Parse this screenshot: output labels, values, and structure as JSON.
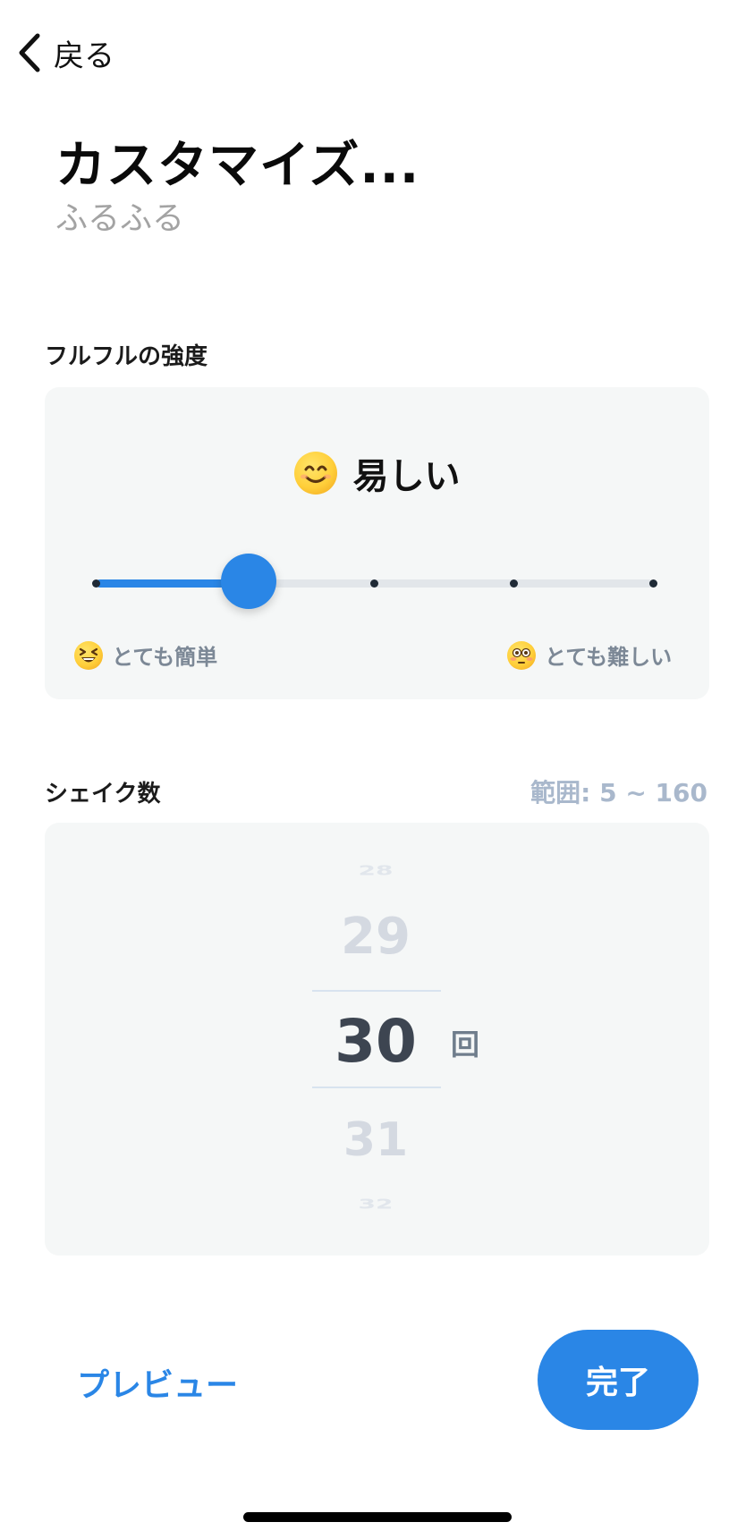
{
  "nav": {
    "back_label": "戻る"
  },
  "header": {
    "title": "カスタマイズ...",
    "subtitle": "ふるふる"
  },
  "intensity": {
    "section_label": "フルフルの強度",
    "current_level": "易しい",
    "current_emoji": "smiling-face-icon",
    "min_label": "とても簡単",
    "min_emoji": "grinning-squinting-face-icon",
    "max_label": "とても難しい",
    "max_emoji": "flushed-face-icon",
    "steps": 5,
    "selected_step": 2
  },
  "shake_count": {
    "section_label": "シェイク数",
    "range_note": "範囲: 5 ~ 160",
    "picker_values": [
      "28",
      "29",
      "30",
      "31",
      "32"
    ],
    "selected_value": "30",
    "unit": "回"
  },
  "actions": {
    "preview_label": "プレビュー",
    "done_label": "完了"
  },
  "colors": {
    "accent": "#2a86e6",
    "card_bg": "#f5f7f7",
    "muted_text": "#a3a3a3",
    "range_note": "#a9b8cc"
  }
}
